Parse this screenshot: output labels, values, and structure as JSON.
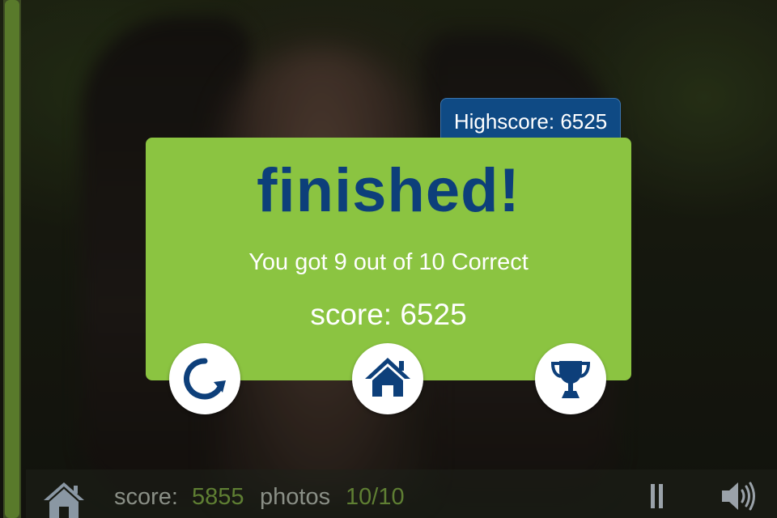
{
  "highscore_label": "Highscore: 6525",
  "result_card": {
    "title": "finished!",
    "result_text": "You got 9 out of 10 Correct",
    "score_text": "score: 6525",
    "correct": 9,
    "total": 10
  },
  "buttons": [
    {
      "name": "replay",
      "icon": "replay-icon"
    },
    {
      "name": "home",
      "icon": "home-icon"
    },
    {
      "name": "leaderboard",
      "icon": "trophy-icon"
    }
  ],
  "status_bar": {
    "score_label": "score:",
    "score_value": "5855",
    "photos_label": "photos",
    "photos_value": "10/10",
    "home_icon": "home-icon",
    "pause_icon": "pause-icon",
    "sound_icon": "speaker-icon"
  },
  "progress": 1.0,
  "colors": {
    "card": "#8bc441",
    "title": "#0d3f7a",
    "highscore_tab": "#0f4a84",
    "accent_green": "#5f7f33",
    "muted_text": "#8a8f86"
  }
}
